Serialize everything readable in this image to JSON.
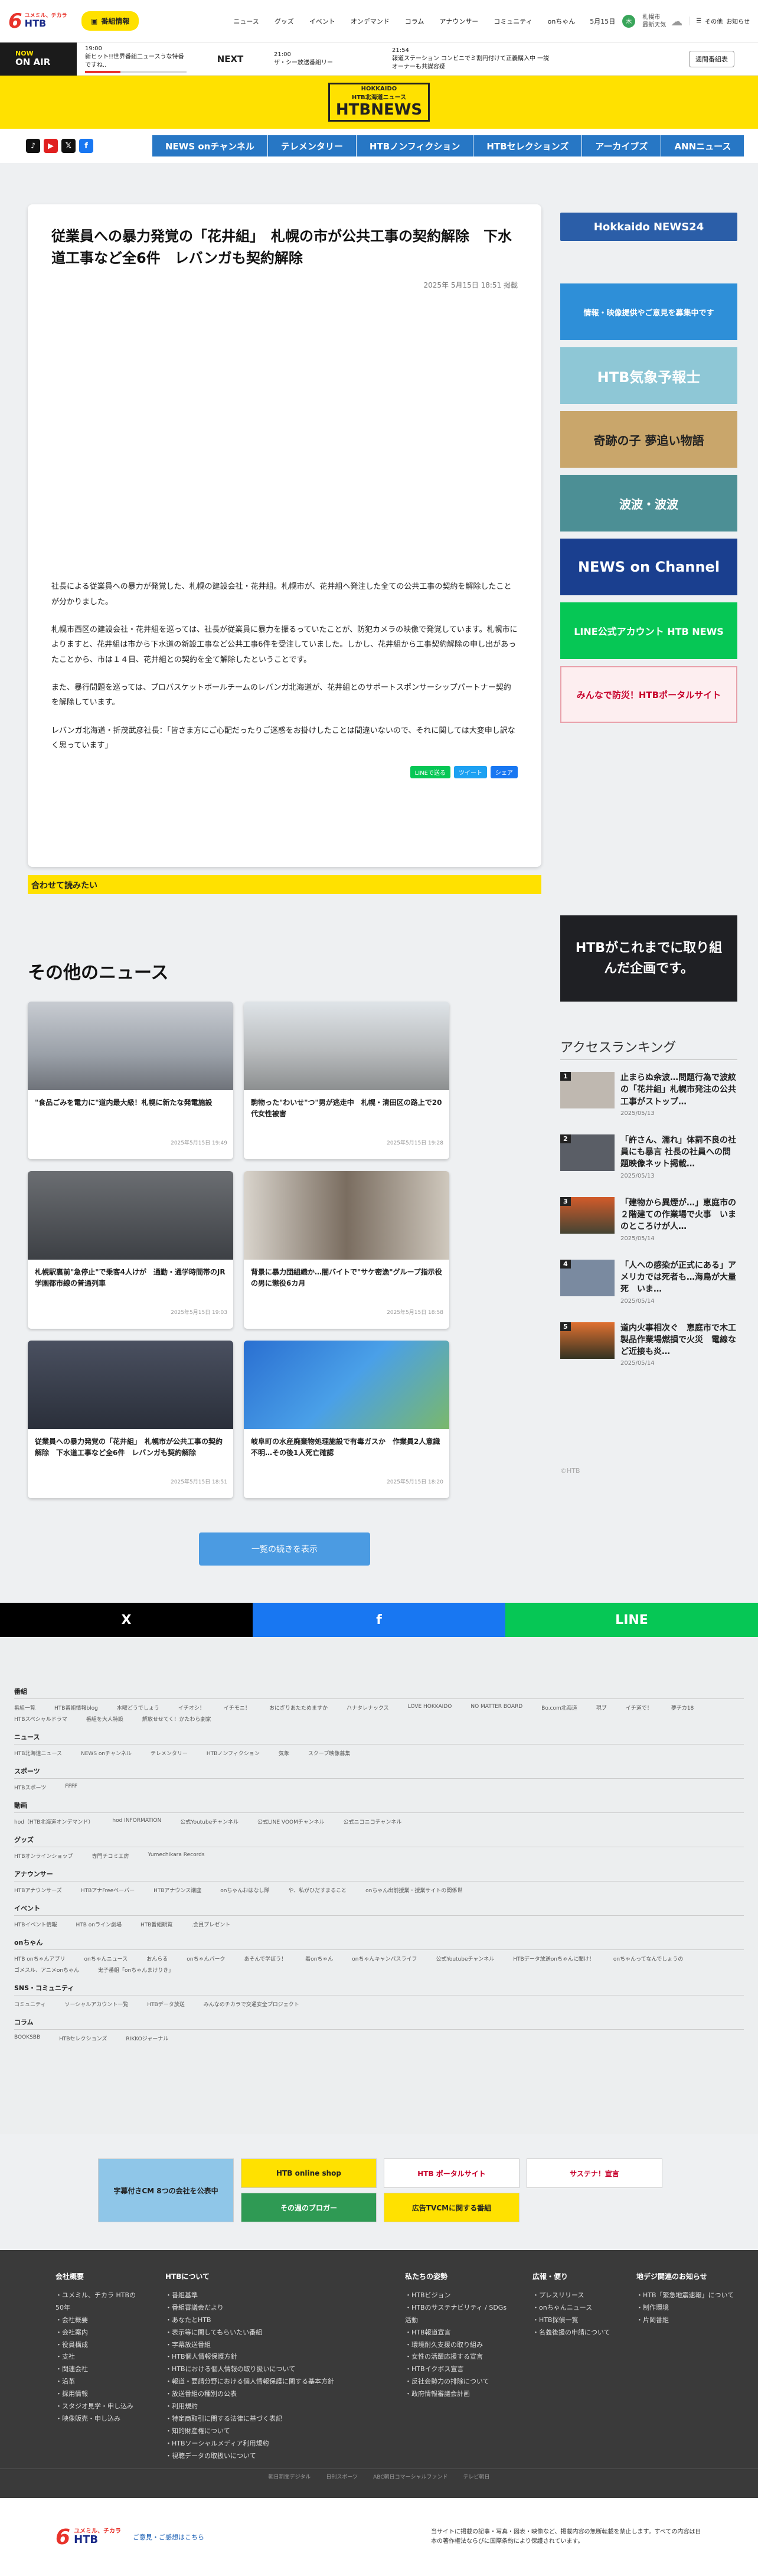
{
  "header": {
    "logo_tagline": "ユメミル、チカラ",
    "logo_brand": "HTB",
    "tv_btn": "番組情報",
    "nav": [
      "ニュース",
      "グッズ",
      "イベント",
      "オンデマンド",
      "コラム",
      "アナウンサー",
      "コミュニティ",
      "onちゃん"
    ],
    "date": "5月15日",
    "weather": "札幌市",
    "weather_link": "最新天気",
    "links": [
      "その他",
      "お知らせ"
    ]
  },
  "onair": {
    "now": "NOW",
    "on_air": "ON AIR",
    "current": {
      "time": "19:00",
      "title": "新ヒット!!世界番組二ュースうな特番ですね..",
      "progress": 0.35
    },
    "next_label": "NEXT",
    "next1": {
      "time": "21:00",
      "title": "ザ・シー放送番組リー"
    },
    "next2": {
      "time": "21:54",
      "title": "報道ステーション コンビニでミ割円付けて正義購入中 一説オーナーも共謀容疑"
    },
    "schedule_btn": "週間番組表"
  },
  "brand": {
    "line1": "HOKKAIDO",
    "line2": "HTB北海道ニュース",
    "line3": "HTBNEWS"
  },
  "nav": {
    "sns": [
      "TikTok",
      "YouTube",
      "X",
      "Facebook"
    ],
    "categories": [
      "NEWS onチャンネル",
      "テレメンタリー",
      "HTBノンフィクション",
      "HTBセレクションズ",
      "アーカイブズ",
      "ANNニュース"
    ]
  },
  "article": {
    "title": "従業員への暴力発覚の「花井組」　札幌の市が公共工事の契約解除　下水道工事など全6件　レバンガも契約解除",
    "date": "2025年 5月15日 18:51 掲載",
    "paragraphs": [
      "社長による従業員への暴力が発覚した、札幌の建設会社・花井組。札幌市が、花井組へ発注した全ての公共工事の契約を解除したことが分かりました。",
      "札幌市西区の建設会社・花井組を巡っては、社長が従業員に暴力を振るっていたことが、防犯カメラの映像で発覚しています。札幌市によりますと、花井組は市から下水道の新設工事など公共工事6件を受注していました。しかし、花井組から工事契約解除の申し出があったことから、市は１４日、花井組との契約を全て解除したということです。",
      "また、暴行問題を巡っては、プロバスケットボールチームのレバンガ北海道が、花井組とのサポートスポンサーシップパートナー契約を解除しています。",
      "レバンガ北海道・折茂武彦社長：「皆さま方にご心配だったりご迷惑をお掛けしたことは間違いないので、それに関しては大変申し訳なく思っています」"
    ],
    "share": [
      "LINEで送る",
      "ツイート",
      "シェア"
    ],
    "read_more": "合わせて読みたい"
  },
  "other_news": {
    "heading": "その他のニュース",
    "items": [
      {
        "title": "\"食品ごみを電力に\"道内最大級！札幌に新たな発電施設",
        "date": "2025年5月15日 19:49"
      },
      {
        "title": "駒物った\"わいせ\"つ\"男が逃走中　札幌・清田区の路上で20代女性被害",
        "date": "2025年5月15日 19:28"
      },
      {
        "title": "札幌駅裏前\"急停止\"で乗客4人けが　通勤・通学時間帯のJR学園都市線の普通列車",
        "date": "2025年5月15日 19:03"
      },
      {
        "title": "背景に暴力団組織か…闇バイトで\"サケ密漁\"グループ指示役の男に懲役6カ月",
        "date": "2025年5月15日 18:58"
      },
      {
        "title": "従業員への暴力発覚の「花井組」　札幌市が公共工事の契約解除　下水道工事など全6件　レバンガも契約解除",
        "date": "2025年5月15日 18:51"
      },
      {
        "title": "岐阜町の水産廃棄物処理施設で有毒ガスか　作業員2人意識不明…その後1人死亡確認",
        "date": "2025年5月15日 18:20"
      }
    ],
    "more_btn": "一覧の続きを表示"
  },
  "sidebar": {
    "top_banner": "Hokkaido NEWS24",
    "banners": [
      "情報・映像提供やご意見を募集中です",
      "HTB気象予報士",
      "奇跡の子 夢追い物語",
      "波波・波波",
      "NEWS on Channel",
      "LINE公式アカウント HTB NEWS",
      "みんなで防災！HTBポータルサイト"
    ],
    "promo": "HTBがこれまでに取り組んだ企画です。",
    "ranking_title": "アクセスランキング",
    "ranking": [
      {
        "title": "止まらぬ余波…問題行為で波紋の「花井組」札幌市発注の公共工事がストップ…",
        "date": "2025/05/13"
      },
      {
        "title": "「許さん、濡れ」体罰不良の社員にも暴言 社長の社員への問題映像ネット掲載…",
        "date": "2025/05/13"
      },
      {
        "title": "「建物から異煙が…」恵庭市の２階建ての作業場で火事　いまのところけが人…",
        "date": "2025/05/14"
      },
      {
        "title": "「人への感染が正式にある」アメリカでは死者も…海鳥が大量死　いま…",
        "date": "2025/05/14"
      },
      {
        "title": "道内火事相次ぐ　恵庭市で木工製品作業場燃損で火災　電線など近接も炎…",
        "date": "2025/05/14"
      }
    ],
    "copyright": "©HTB"
  },
  "share_bar": [
    "X",
    "f",
    "LINE"
  ],
  "sitemap": [
    {
      "h": "番組",
      "items": [
        "番組一覧",
        "HTB番組情報blog",
        "水曜どうでしょう",
        "イチオシ！",
        "イチモニ！",
        "おにぎりあたためますか",
        "ハナタレナックス",
        "LOVE HOKKAIDO",
        "NO MATTER BOARD",
        "Bo.com北海道",
        "現ブ",
        "イチ道で！",
        "夢チカ18",
        "HTBスペシャルドラマ",
        "番組を大人特設",
        "解放せせてく！かたわら劇家"
      ]
    },
    {
      "h": "ニュース",
      "items": [
        "HTB北海道ニュース",
        "NEWS onチャンネル",
        "テレメンタリー",
        "HTBノンフィクション",
        "気象",
        "スクープ映像募集"
      ]
    },
    {
      "h": "スポーツ",
      "items": [
        "HTBスポーツ",
        "FFFF"
      ]
    },
    {
      "h": "動画",
      "items": [
        "hod（HTB北海道オンデマンド）",
        "hod INFORMATION",
        "公式Youtubeチャンネル",
        "公式LINE VOOMチャンネル",
        "公式ニコニコチャンネル"
      ]
    },
    {
      "h": "グッズ",
      "items": [
        "HTBオンラインショップ",
        "専門チコミ工房",
        "Yumechikara Records"
      ]
    },
    {
      "h": "アナウンサー",
      "items": [
        "HTBアナウンサーズ",
        "HTBアナFreeペーパー",
        "HTBアナウンス講座",
        "onちゃんおはなし隊",
        "や、私がひだすまること",
        "onちゃん出前授業・授業サイトの関係世"
      ]
    },
    {
      "h": "イベント",
      "items": [
        "HTBイベント情報",
        "HTB onライン劇場",
        "HTB番組観覧",
        ".会員プレゼント"
      ]
    },
    {
      "h": "onちゃん",
      "items": [
        "HTB onちゃんアプリ",
        "onちゃんニュース",
        "おんらる",
        "onちゃんパーク",
        "あそんで学ぼう！",
        "着onちゃん",
        "onちゃんキャンパスライフ",
        "公式Youtubeチャンネル",
        "HTBデータ放送onちゃんに聞け！",
        "onちゃんってなんでしょうの",
        "ゴメスル、アニメonちゃん",
        "鬼子番組「onちゃんまけりき」"
      ]
    },
    {
      "h": "SNS・コミュニティ",
      "items": [
        "コミュニティ",
        "ソーシャルアカウント一覧",
        "HTBデータ放送",
        "みんなのチカラで交通安全プロジェクト"
      ]
    },
    {
      "h": "コラム",
      "items": [
        "BOOKSBB",
        "HTBセレクションズ",
        "RIKKOジャーナル"
      ]
    }
  ],
  "ads": [
    "字幕付きCM 8つの会社を公表中",
    "HTB online shop",
    "HTB ポータルサイト",
    "サステナ！宣言",
    "その週のブロガー",
    "広告TVCMに関する番組"
  ],
  "footer": {
    "cols": [
      {
        "h": "会社概要",
        "items": [
          "ユメミル、チカラ HTBの50年",
          "会社概要",
          "会社案内",
          "役員構成",
          "支社",
          "関連会社",
          "沿革",
          "採用情報",
          "スタジオ見学・申し込み",
          "映像販売・申し込み"
        ]
      },
      {
        "h": "HTBについて",
        "items": [
          "番組基準",
          "番組審議会だより",
          "あなたとHTB",
          "表示等に関してもらいたい番組",
          "字幕放送番組",
          "HTB個人情報保護方針",
          "HTBにおける個人情報の取り扱いについて",
          "報道・要請分野における個人情報保護に関する基本方針",
          "放送番組の種別の公表",
          "利用規約",
          "特定商取引に関する法律に基づく表記",
          "知的財産権について",
          "HTBソーシャルメディア利用規約",
          "視聴データの取扱いについて"
        ]
      },
      {
        "h": "私たちの姿勢",
        "items": [
          "HTBビジョン",
          "HTBのサステナビリティ / SDGs活動",
          "HTB報道宣言",
          "環境耐久支援の取り組み",
          "女性の活躍応援する宣言",
          "HTBイクボス宣言",
          "反社会勢力の排除について",
          "政府情報審議会計画"
        ]
      },
      {
        "h": "広報・便り",
        "items": [
          "プレスリリース",
          "onちゃんニュース",
          "HTB探偵一覧",
          "名義後援の申請について"
        ]
      },
      {
        "h": "地デジ関連のお知らせ",
        "items": [
          "HTB「緊急地震速報」について",
          "",
          "制作環境",
          "",
          "片岡番組"
        ]
      }
    ],
    "bottom": [
      "朝日新聞デジタル",
      "日刊スポーツ",
      "ABC朝日コマーシャルファンド",
      "テレビ朝日"
    ],
    "brand": "ユメミル、チカラ",
    "brand_htb": "HTB",
    "contact": "ご意見・ご感想はこちら",
    "caption": "当サイトに掲載の記事・写真・図表・映像など、掲載内容の無断転載を禁止します。すべての内容は日本の著作権法ならびに国際条約により保護されています。"
  },
  "colors": {
    "yellow": "#ffe100",
    "blue": "#2777c5",
    "red": "#e8332b",
    "navy": "#1a2a88"
  }
}
